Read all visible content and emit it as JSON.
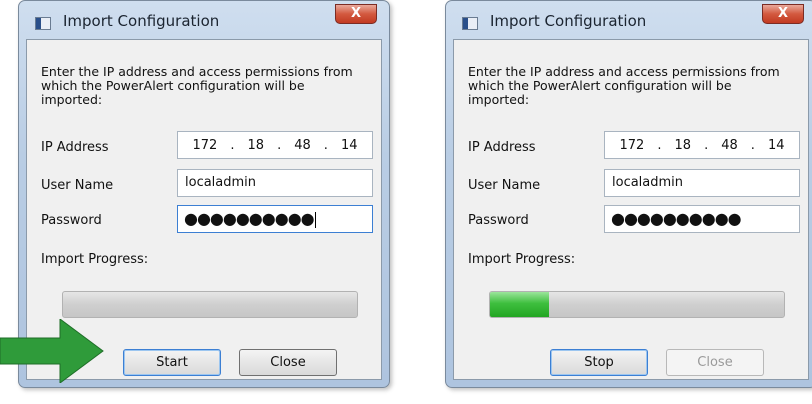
{
  "colors": {
    "pointer_arrow": "#2f9b3a",
    "progress_fill": "#3fbf3f",
    "close_button": "#c94a33"
  },
  "dialogs": [
    {
      "title": "Import Configuration",
      "close_glyph": "X",
      "description": "Enter the IP address and access permissions from\nwhich the PowerAlert configuration will be\nimported:",
      "ip_label": "IP Address",
      "ip_octets": [
        "172",
        ".",
        "18",
        ".",
        "48",
        ".",
        "14"
      ],
      "username_label": "User Name",
      "username_value": "localadmin",
      "password_label": "Password",
      "password_value": "●●●●●●●●●●",
      "progress_label": "Import Progress:",
      "progress_percent": 0,
      "buttons": [
        {
          "label": "Start"
        },
        {
          "label": "Close"
        }
      ]
    },
    {
      "title": "Import Configuration",
      "close_glyph": "X",
      "description": "Enter the IP address and access permissions from\nwhich the PowerAlert configuration will be\nimported:",
      "ip_label": "IP Address",
      "ip_octets": [
        "172",
        ".",
        "18",
        ".",
        "48",
        ".",
        "14"
      ],
      "username_label": "User Name",
      "username_value": "localadmin",
      "password_label": "Password",
      "password_value": "●●●●●●●●●●",
      "progress_label": "Import Progress:",
      "progress_percent": 20,
      "buttons": [
        {
          "label": "Stop"
        },
        {
          "label": "Close"
        }
      ]
    }
  ]
}
